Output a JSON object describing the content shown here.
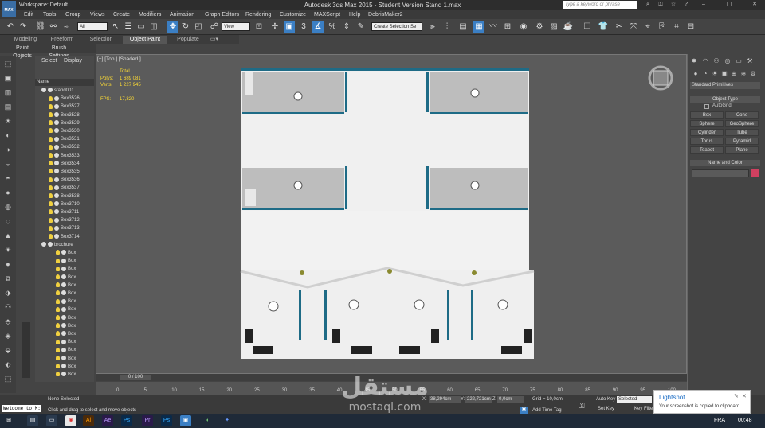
{
  "titlebar": {
    "logo": "MAX",
    "workspace": "Workspace: Default",
    "title": "Autodesk 3ds Max  2015   - Student Version    Stand 1.max",
    "search_placeholder": "Type a keyword or phrase"
  },
  "menu": [
    "Edit",
    "Tools",
    "Group",
    "Views",
    "Create",
    "Modifiers",
    "Animation",
    "Graph Editors",
    "Rendering",
    "Customize",
    "MAXScript",
    "Help",
    "DebrisMaker2"
  ],
  "toolbar": {
    "filter": "All",
    "view": "View",
    "selection_set": "Create Selection Se"
  },
  "ribbon": {
    "tabs": [
      "Modeling",
      "Freeform",
      "Selection",
      "Object Paint",
      "Populate"
    ],
    "active": "Object Paint",
    "sub": [
      "Paint Objects",
      "Brush Settings"
    ]
  },
  "explorer": {
    "tabs": [
      "Select",
      "Display"
    ],
    "column": "Name",
    "items": [
      "stand001",
      "Box3526",
      "Box3527",
      "Box3528",
      "Box3529",
      "Box3530",
      "Box3531",
      "Box3532",
      "Box3533",
      "Box3534",
      "Box3535",
      "Box3536",
      "Box3537",
      "Box3538",
      "Box3710",
      "Box3711",
      "Box3712",
      "Box3713",
      "Box3714",
      "brochure",
      "Box",
      "Box",
      "Box",
      "Box",
      "Box",
      "Box",
      "Box",
      "Box",
      "Box",
      "Box",
      "Box",
      "Box",
      "Box",
      "Box",
      "Box",
      "Box"
    ]
  },
  "viewport": {
    "label": "[+] [Top ] [Shaded ]",
    "stats_title": "Total",
    "polys_label": "Polys:",
    "polys": "1 689 081",
    "verts_label": "Verts:",
    "verts": "1 227 945",
    "fps_label": "FPS:",
    "fps": "17,320"
  },
  "command_panel": {
    "category": "Standard Primitives",
    "object_type": "Object Type",
    "autogrid": "AutoGrid",
    "primitives": [
      "Box",
      "Cone",
      "Sphere",
      "GeoSphere",
      "Cylinder",
      "Tube",
      "Torus",
      "Pyramid",
      "Teapot",
      "Plane"
    ],
    "name_color": "Name and Color"
  },
  "timeline": {
    "frame": "0 / 100",
    "ticks": [
      "0",
      "5",
      "10",
      "15",
      "20",
      "25",
      "30",
      "35",
      "40",
      "45",
      "50",
      "55",
      "60",
      "65",
      "70",
      "75",
      "80",
      "85",
      "90",
      "95",
      "100"
    ]
  },
  "status": {
    "welcome": "Welcome to M:",
    "selection": "None Selected",
    "prompt": "Click and drag to select and move objects",
    "x_label": "X:",
    "x": "38,294cm",
    "y_label": "Y:",
    "y": "222,721cm",
    "z_label": "Z:",
    "z": "0,0cm",
    "grid": "Grid = 10,0cm",
    "add_time_tag": "Add Time Tag",
    "auto_key": "Auto Key",
    "selected": "Selected",
    "set_key": "Set Key",
    "key_filters": "Key Filters..."
  },
  "lightshot": {
    "title": "Lightshot",
    "message": "Your screenshot is copied to clipboard"
  },
  "taskbar": {
    "lang": "FRA",
    "time": "00:48"
  },
  "watermark": {
    "arabic": "مستقل",
    "latin": "mostaql.com"
  },
  "colors": {
    "accent": "#3b7fc4",
    "floor": "#f0f0f0",
    "wall_teal": "#1e6b86",
    "stats_yellow": "#ffdd33"
  }
}
